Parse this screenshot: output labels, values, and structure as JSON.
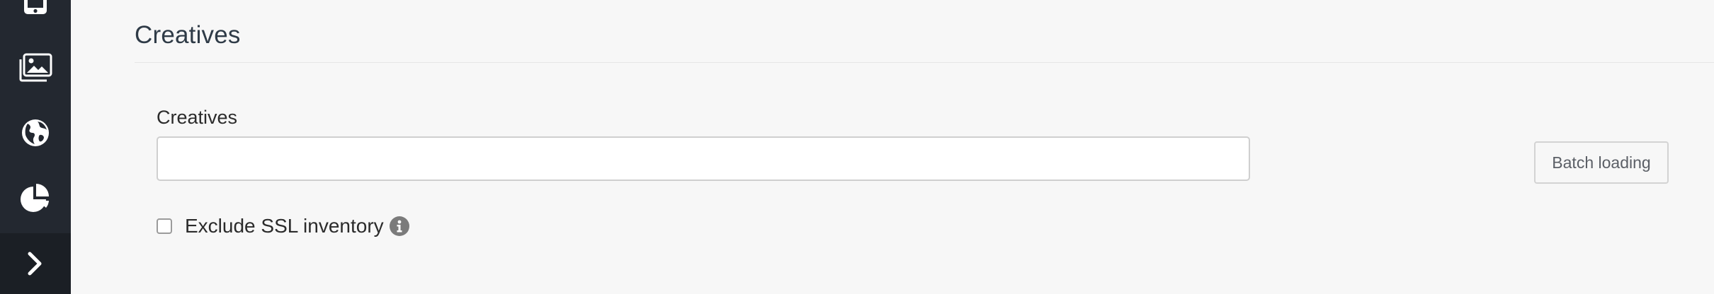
{
  "sidebar": {
    "items": [
      {
        "icon": "tablet-icon"
      },
      {
        "icon": "images-icon"
      },
      {
        "icon": "globe-icon"
      },
      {
        "icon": "pie-chart-icon"
      },
      {
        "icon": "chevron-right-icon"
      }
    ]
  },
  "section": {
    "title": "Creatives"
  },
  "creatives_field": {
    "label": "Creatives",
    "value": "",
    "placeholder": ""
  },
  "batch_button": {
    "label": "Batch loading"
  },
  "exclude_ssl": {
    "label": "Exclude SSL inventory",
    "checked": false
  },
  "colors": {
    "sidebar_bg": "#232830",
    "page_bg": "#f7f7f7",
    "title_text": "#2f3b47",
    "info_icon": "#7b7b7b"
  }
}
